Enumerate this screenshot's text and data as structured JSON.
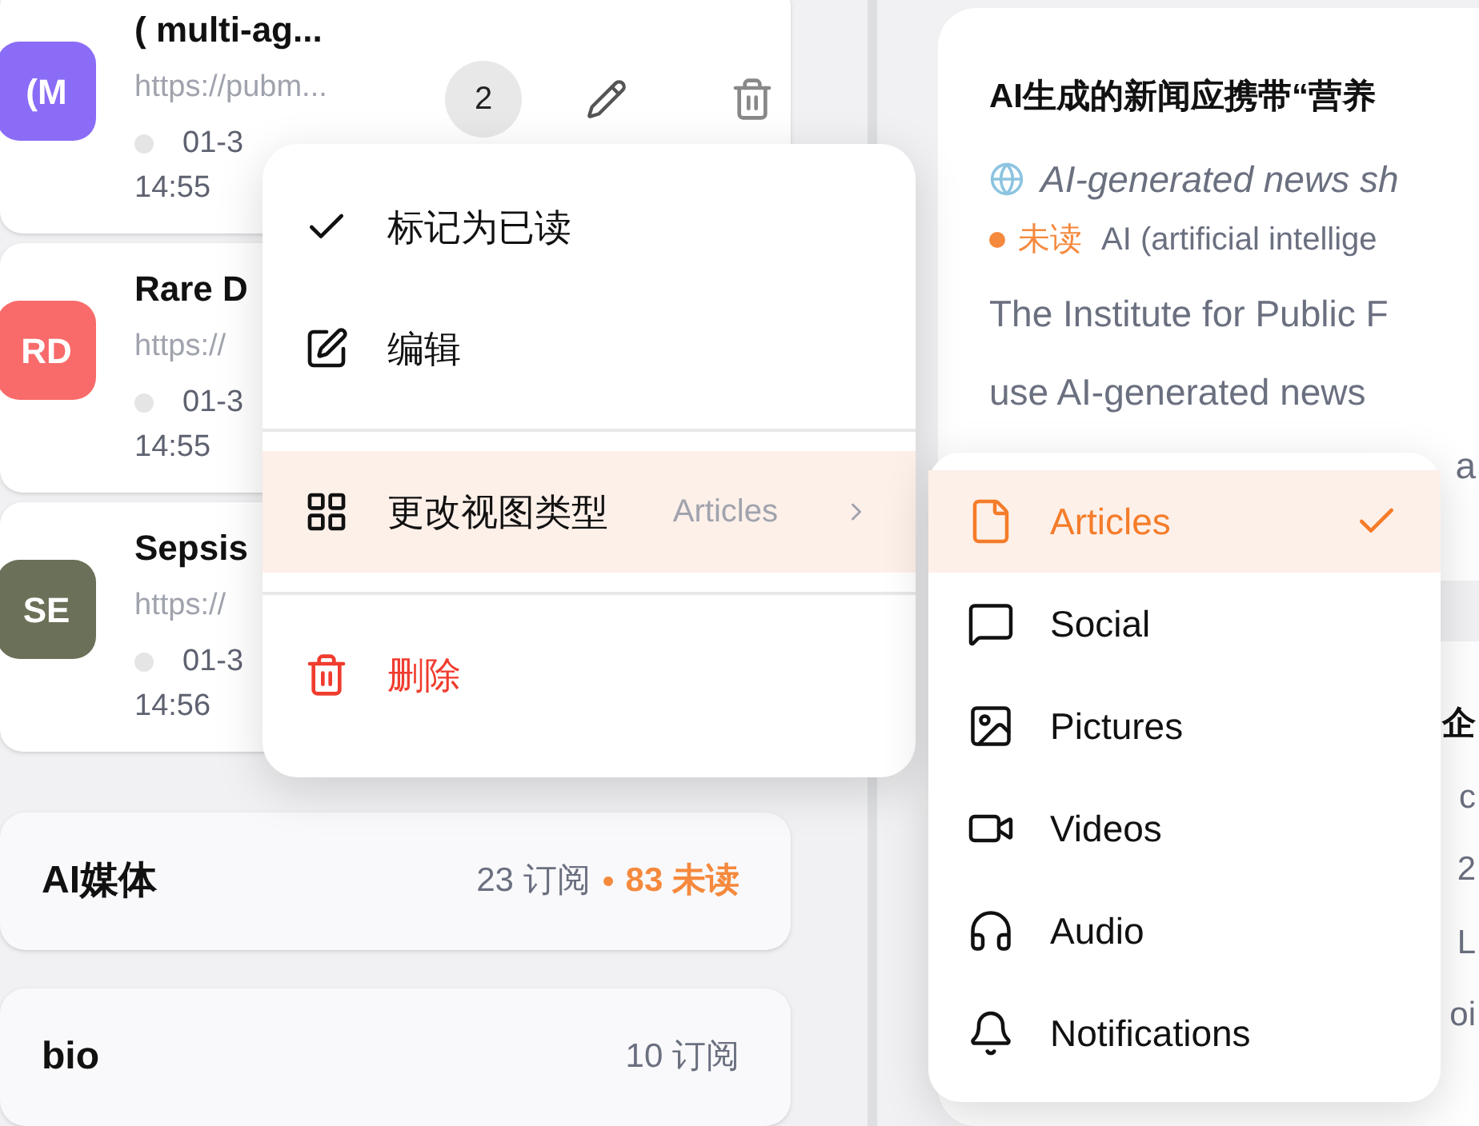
{
  "feeds": [
    {
      "avatar": "(M",
      "color": "#8b6cf6",
      "title": "( multi-ag...",
      "url": "https://pubm...",
      "date": "01-3",
      "time": "14:55",
      "count": "2"
    },
    {
      "avatar": "RD",
      "color": "#f96b6b",
      "title": "Rare D",
      "url": "https://",
      "date": "01-3",
      "time": "14:55"
    },
    {
      "avatar": "SE",
      "color": "#6b7058",
      "title": "Sepsis",
      "url": "https://",
      "date": "01-3",
      "time": "14:56"
    }
  ],
  "groups": [
    {
      "name": "AI媒体",
      "subscriptions": "23 订阅",
      "unread": "83 未读"
    },
    {
      "name": "bio",
      "subscriptions": "10 订阅"
    }
  ],
  "context_menu": {
    "sections": [
      [
        {
          "label": "标记为已读",
          "highlighted": false,
          "danger": false
        },
        {
          "label": "编辑",
          "highlighted": false,
          "danger": false
        }
      ],
      [
        {
          "label": "更改视图类型",
          "value": "Articles",
          "highlighted": true,
          "danger": false
        }
      ],
      [
        {
          "label": "删除",
          "highlighted": false,
          "danger": true
        }
      ]
    ]
  },
  "view_menu": [
    {
      "label": "Articles",
      "selected": true
    },
    {
      "label": "Social",
      "selected": false
    },
    {
      "label": "Pictures",
      "selected": false
    },
    {
      "label": "Videos",
      "selected": false
    },
    {
      "label": "Audio",
      "selected": false
    },
    {
      "label": "Notifications",
      "selected": false
    }
  ],
  "article": {
    "title": "AI生成的新闻应携带“营养",
    "subtitle": "AI-generated news sh",
    "status": "未读",
    "excerpt_lead": "AI (artificial intellige",
    "body": [
      "The Institute for Public F",
      "use AI-generated news"
    ],
    "body_tail": "a"
  },
  "article_2_fragments": [
    "企",
    "c",
    "2",
    "L",
    "oi"
  ]
}
